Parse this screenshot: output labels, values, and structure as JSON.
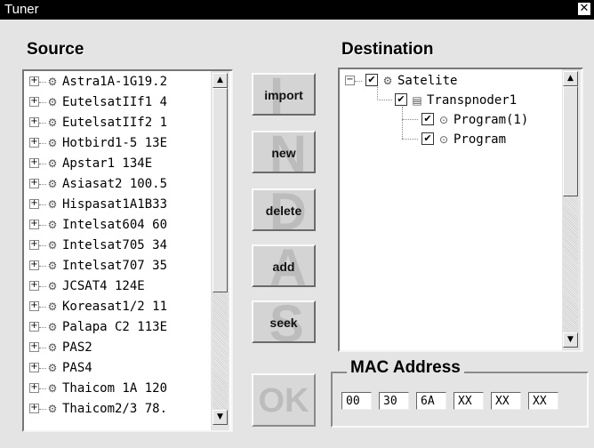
{
  "window": {
    "title": "Tuner",
    "close": "✕"
  },
  "source": {
    "heading": "Source",
    "items": [
      "Astra1A-1G19.2",
      "EutelsatIIf1 4",
      "EutelsatIIf2 1",
      "Hotbird1-5 13E",
      "Apstar1 134E",
      "Asiasat2 100.5",
      "Hispasat1A1B33",
      "Intelsat604 60",
      "Intelsat705 34",
      "Intelsat707 35",
      "JCSAT4 124E",
      "Koreasat1/2 11",
      "Palapa C2 113E",
      "PAS2",
      "PAS4",
      "Thaicom 1A 120",
      "Thaicom2/3 78."
    ]
  },
  "actions": {
    "import": {
      "big": "I",
      "label": "import"
    },
    "new": {
      "big": "N",
      "label": "new"
    },
    "delete": {
      "big": "D",
      "label": "delete"
    },
    "add": {
      "big": "A",
      "label": "add"
    },
    "seek": {
      "big": "S",
      "label": "seek"
    },
    "ok": "OK"
  },
  "destination": {
    "heading": "Destination",
    "root": "Satelite",
    "transponder": "Transpnoder1",
    "programs": [
      "Program(1)",
      "Program"
    ]
  },
  "mac": {
    "heading": "MAC Address",
    "fields": [
      "00",
      "30",
      "6A",
      "XX",
      "XX",
      "XX"
    ]
  }
}
